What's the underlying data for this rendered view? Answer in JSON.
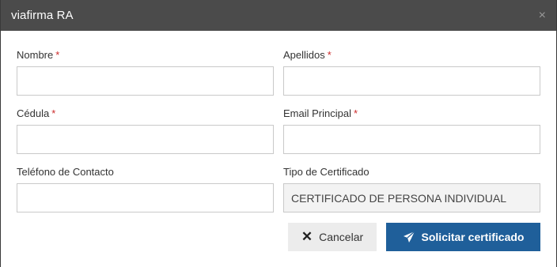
{
  "window": {
    "title": "viafirma RA",
    "close_glyph": "×"
  },
  "form": {
    "nombre": {
      "label": "Nombre",
      "required_mark": "*",
      "value": ""
    },
    "apellidos": {
      "label": "Apellidos",
      "required_mark": "*",
      "value": ""
    },
    "cedula": {
      "label": "Cédula",
      "required_mark": "*",
      "value": ""
    },
    "email": {
      "label": "Email Principal",
      "required_mark": "*",
      "value": ""
    },
    "telefono": {
      "label": "Teléfono de Contacto",
      "value": ""
    },
    "tipo_certificado": {
      "label": "Tipo de Certificado",
      "value": "CERTIFICADO DE PERSONA INDIVIDUAL"
    }
  },
  "buttons": {
    "cancel": {
      "label": "Cancelar",
      "icon": "x-icon",
      "glyph": "✕"
    },
    "submit": {
      "label": "Solicitar certificado",
      "icon": "paper-plane-icon"
    }
  },
  "colors": {
    "titlebar": "#4b4b4b",
    "required": "#cc2a2a",
    "submit_button": "#1f5f9a",
    "cancel_button": "#ececec"
  }
}
